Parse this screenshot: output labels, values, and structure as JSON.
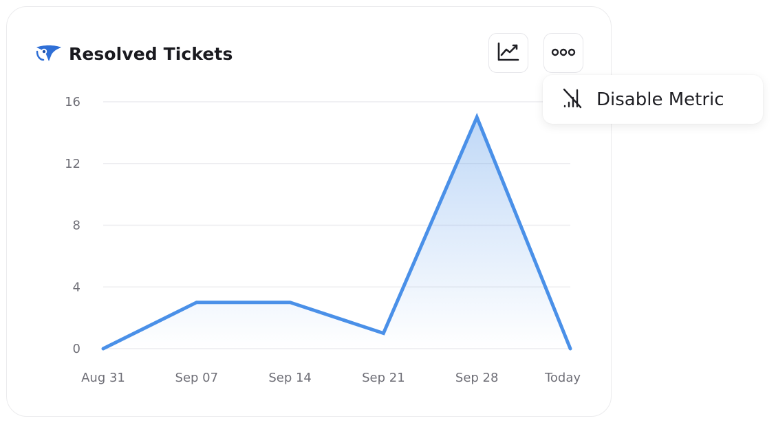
{
  "widget": {
    "title": "Resolved Tickets",
    "logo": "owl-logo",
    "accent_color": "#4a90e8"
  },
  "toolbar": {
    "chart_button_icon": "line-chart-icon",
    "more_button_icon": "more-dots-icon"
  },
  "menu": {
    "items": [
      {
        "label": "Disable Metric",
        "icon": "signal-off-icon"
      }
    ]
  },
  "chart_data": {
    "type": "area",
    "categories": [
      "Aug 31",
      "Sep 07",
      "Sep 14",
      "Sep 21",
      "Sep 28",
      "Today"
    ],
    "values": [
      0,
      3,
      3,
      1,
      15,
      0
    ],
    "title": "",
    "xlabel": "",
    "ylabel": "",
    "ylim": [
      0,
      16
    ],
    "yticks": [
      0,
      4,
      8,
      12,
      16
    ],
    "grid": true,
    "line_color": "#4a90e8",
    "fill_color": "#4a90e8"
  }
}
